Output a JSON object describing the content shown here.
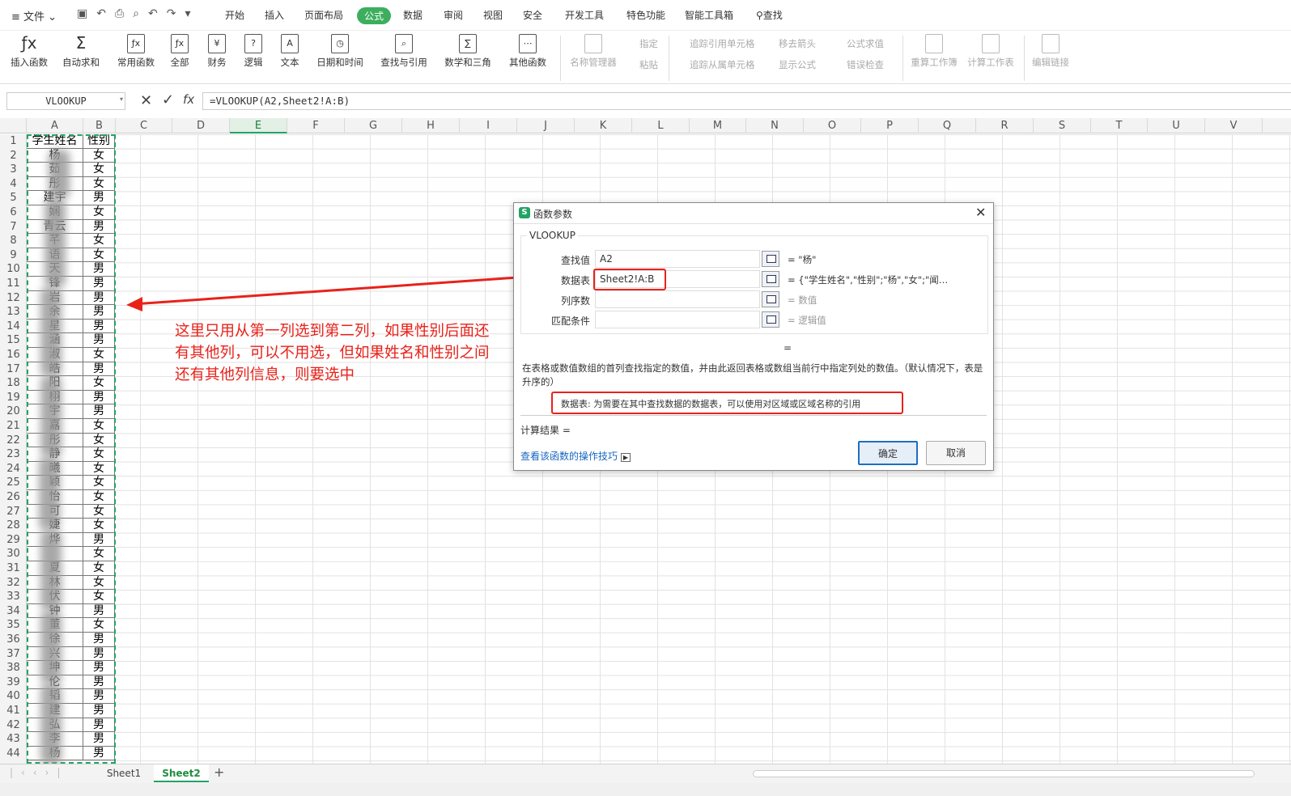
{
  "menubar": {
    "file": "文件",
    "tabs": [
      "开始",
      "插入",
      "页面布局",
      "公式",
      "数据",
      "审阅",
      "视图",
      "安全",
      "开发工具",
      "特色功能",
      "智能工具箱"
    ],
    "search": "查找",
    "active_index": 3
  },
  "ribbon": {
    "buttons": [
      "插入函数",
      "自动求和",
      "常用函数",
      "全部",
      "财务",
      "逻辑",
      "文本",
      "日期和时间",
      "查找与引用",
      "数学和三角",
      "其他函数"
    ],
    "disabled": [
      "名称管理器",
      "粘贴",
      "指定",
      "追踪引用单元格",
      "追踪从属单元格",
      "移去箭头",
      "显示公式",
      "公式求值",
      "错误检查",
      "重算工作簿",
      "计算工作表",
      "编辑链接"
    ]
  },
  "formula_bar": {
    "name_box": "VLOOKUP",
    "fx": "fx",
    "formula": "=VLOOKUP(A2,Sheet2!A:B)"
  },
  "columns": [
    "A",
    "B",
    "C",
    "D",
    "E",
    "F",
    "G",
    "H",
    "I",
    "J",
    "K",
    "L",
    "M",
    "N",
    "O",
    "P",
    "Q",
    "R",
    "S",
    "T",
    "U",
    "V"
  ],
  "sheet": {
    "headers": [
      "学生姓名",
      "性别"
    ],
    "names": [
      "杨",
      "茹",
      "彤",
      "建宇",
      "娴",
      "青云",
      "芊",
      "语",
      "天",
      "锋",
      "岩",
      "余",
      "星",
      "涵",
      "淑",
      "皓",
      "阳",
      "栩",
      "宇",
      "嘉",
      "彤",
      "静",
      "曦",
      "颖",
      "怡",
      "可",
      "婕",
      "烨",
      "",
      "夏",
      "林",
      "伏",
      "钟",
      "董",
      "徐",
      "兴",
      "坤",
      "伦",
      "韬",
      "建",
      "弘",
      "李",
      "杨"
    ],
    "genders": [
      "女",
      "女",
      "女",
      "男",
      "女",
      "男",
      "女",
      "女",
      "男",
      "男",
      "男",
      "男",
      "男",
      "男",
      "女",
      "男",
      "女",
      "男",
      "男",
      "女",
      "女",
      "女",
      "女",
      "女",
      "女",
      "女",
      "女",
      "男",
      "女",
      "女",
      "女",
      "女",
      "男",
      "女",
      "男",
      "男",
      "男",
      "男",
      "男",
      "男",
      "男",
      "男",
      "男"
    ]
  },
  "annotation": "这里只用从第一列选到第二列，如果性别后面还有其他列，可以不用选，但如果姓名和性别之间还有其他列信息，则要选中",
  "dialog": {
    "title": "函数参数",
    "func": "VLOOKUP",
    "args": [
      {
        "label": "查找值",
        "value": "A2",
        "result": "= \"杨\""
      },
      {
        "label": "数据表",
        "value": "Sheet2!A:B",
        "result": "= {\"学生姓名\",\"性别\";\"杨\",\"女\";\"闻…"
      },
      {
        "label": "列序数",
        "value": "",
        "result": "= 数值"
      },
      {
        "label": "匹配条件",
        "value": "",
        "result": "= 逻辑值"
      }
    ],
    "equals": "=",
    "description": "在表格或数值数组的首列查找指定的数值，并由此返回表格或数组当前行中指定列处的数值。（默认情况下，表是升序的）",
    "param_help": "数据表:   为需要在其中查找数据的数据表，可以使用对区域或区域名称的引用",
    "result_label": "计算结果  =",
    "tips_link": "查看该函数的操作技巧",
    "ok": "确定",
    "cancel": "取消"
  },
  "sheets": [
    "Sheet1",
    "Sheet2"
  ],
  "colors": {
    "accent": "#3dae5e",
    "annotation": "#e8221a"
  }
}
